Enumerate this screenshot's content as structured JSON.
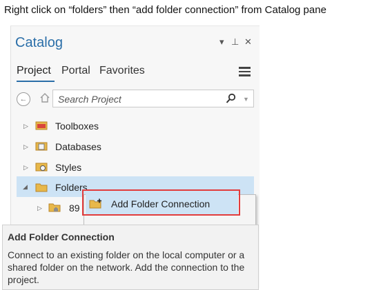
{
  "instruction": "Right click on “folders” then “add folder connection” from Catalog pane",
  "pane": {
    "title": "Catalog",
    "controls": {
      "menu": "▾",
      "pin": "⊥",
      "close": "✕"
    },
    "tabs": [
      {
        "label": "Project",
        "active": true
      },
      {
        "label": "Portal",
        "active": false
      },
      {
        "label": "Favorites",
        "active": false
      }
    ],
    "search": {
      "placeholder": "Search Project"
    }
  },
  "tree": {
    "items": [
      {
        "label": "Toolboxes",
        "icon": "toolbox-icon",
        "expanded": false
      },
      {
        "label": "Databases",
        "icon": "database-icon",
        "expanded": false
      },
      {
        "label": "Styles",
        "icon": "styles-icon",
        "expanded": false
      },
      {
        "label": "Folders",
        "icon": "folder-icon",
        "expanded": true,
        "selected": true
      },
      {
        "label": "89",
        "icon": "folder-home-icon",
        "expanded": false
      }
    ]
  },
  "context_menu": {
    "items": [
      {
        "label": "Add Folder Connection",
        "icon": "add-folder-icon"
      }
    ]
  },
  "tooltip": {
    "title": "Add Folder Connection",
    "body": "Connect to an existing folder on the local computer or a shared folder on the network. Add the connection to the project."
  },
  "colors": {
    "accent": "#2a6ea8",
    "selection": "#cde3f5",
    "highlight_box": "#e23b3b"
  }
}
